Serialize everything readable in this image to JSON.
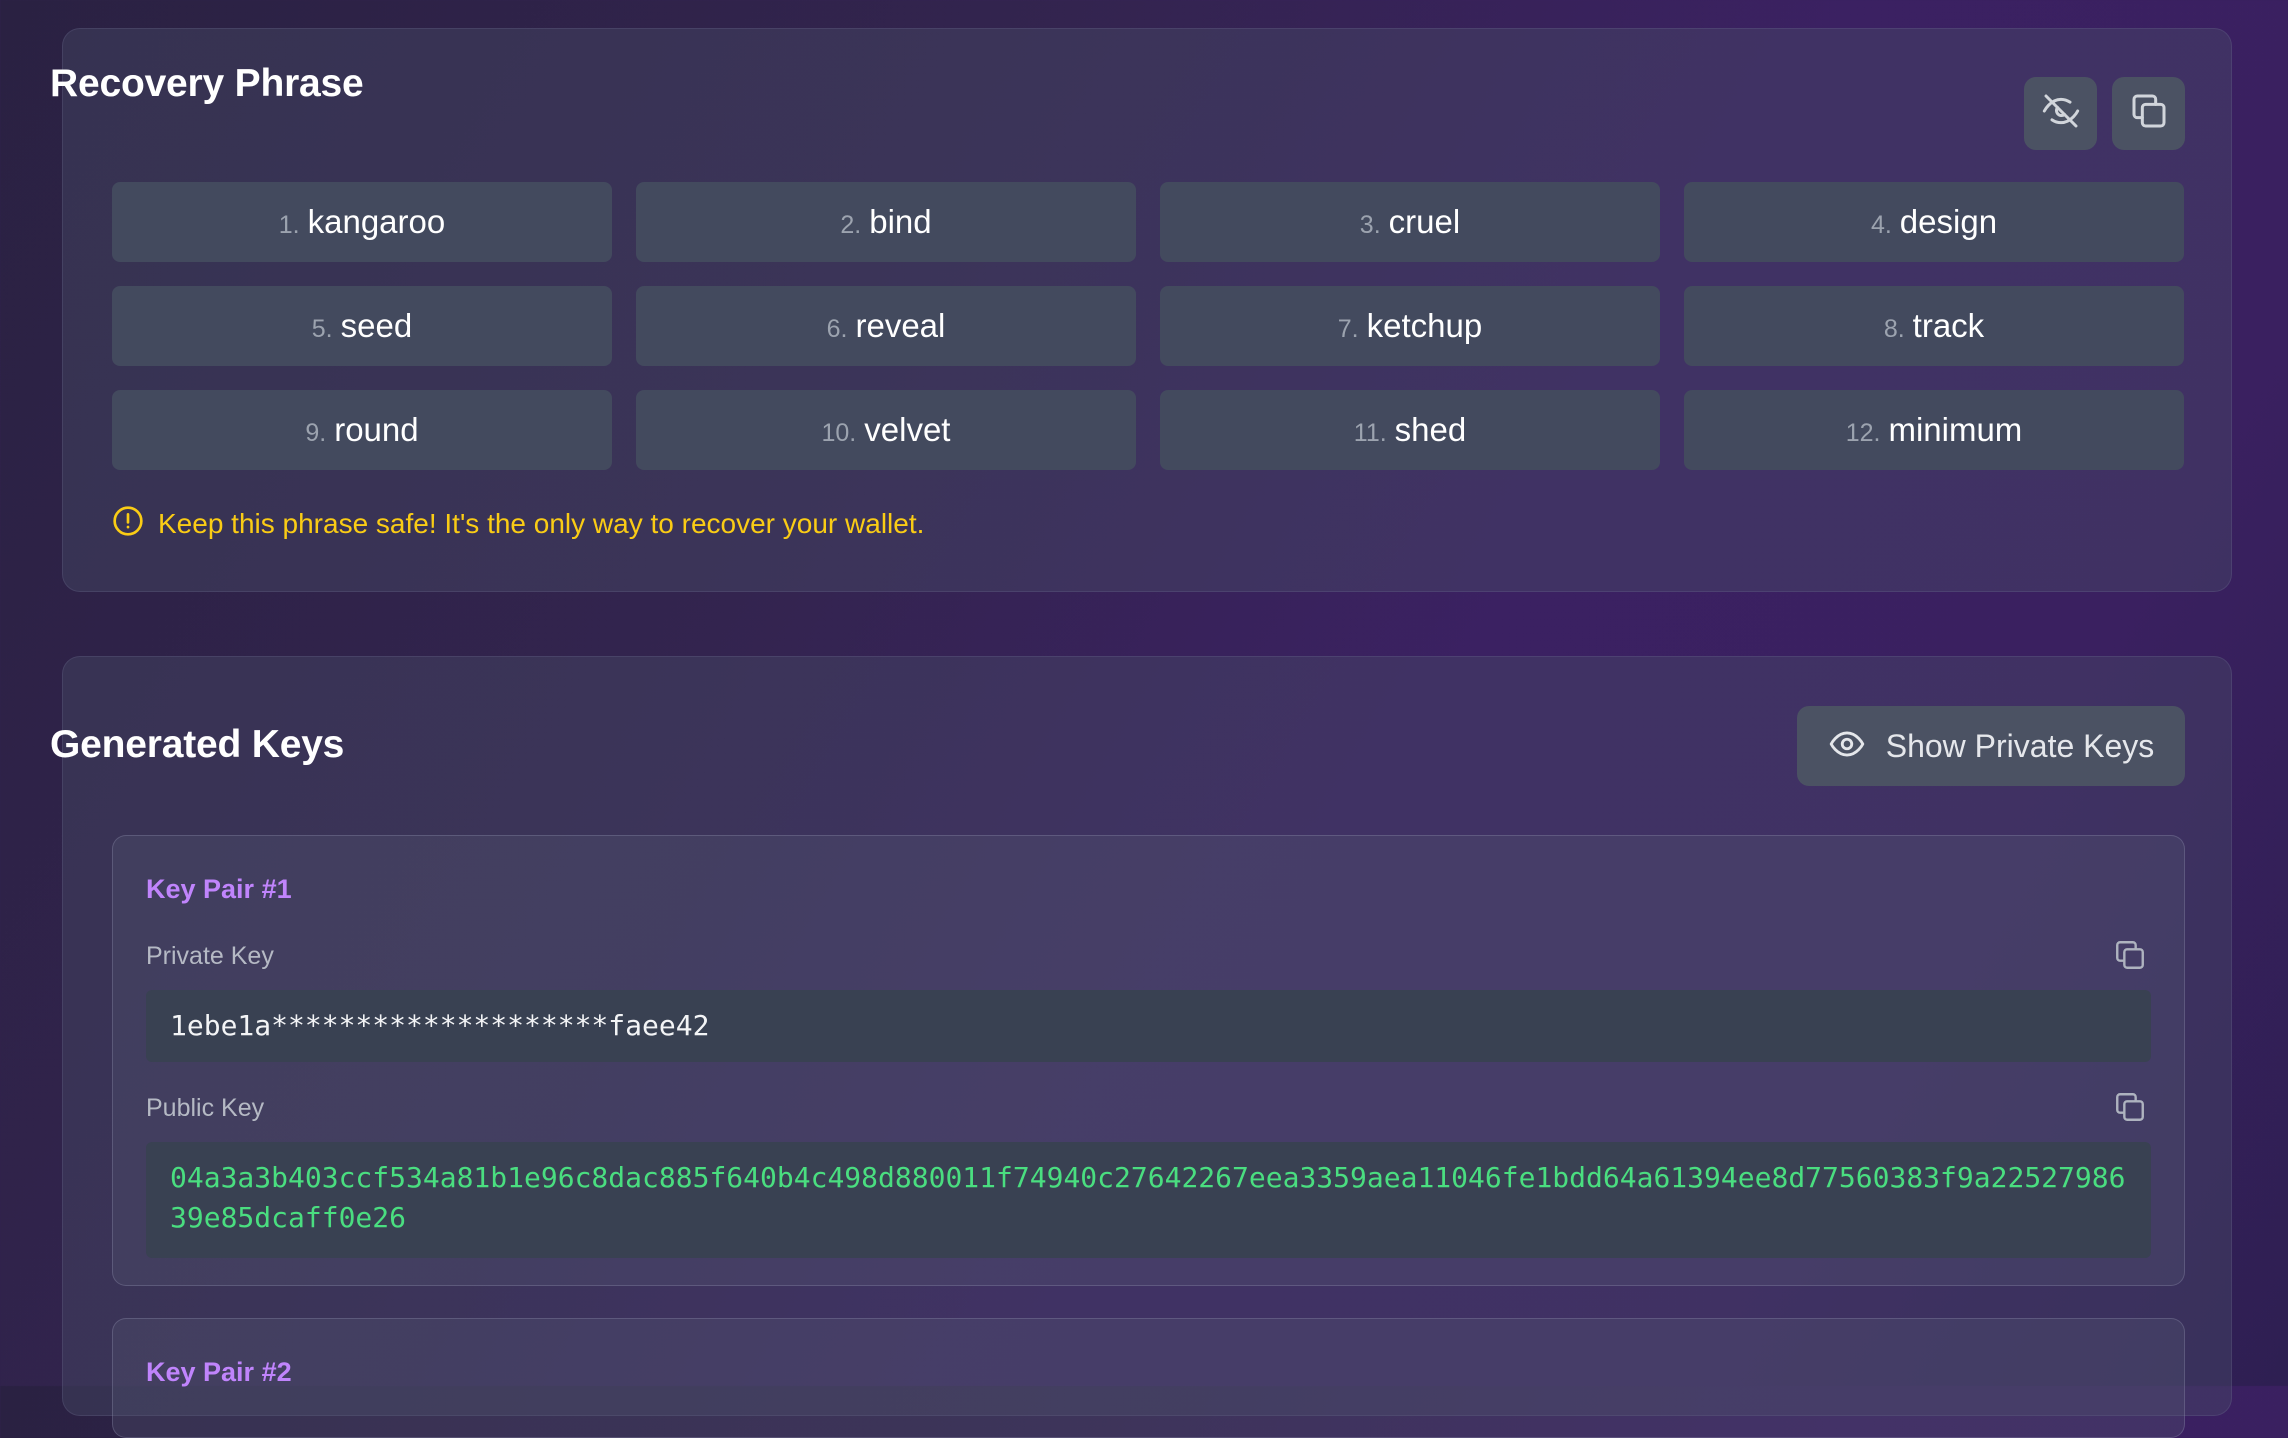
{
  "recovery": {
    "title": "Recovery Phrase",
    "words": [
      {
        "num": "1.",
        "word": "kangaroo"
      },
      {
        "num": "2.",
        "word": "bind"
      },
      {
        "num": "3.",
        "word": "cruel"
      },
      {
        "num": "4.",
        "word": "design"
      },
      {
        "num": "5.",
        "word": "seed"
      },
      {
        "num": "6.",
        "word": "reveal"
      },
      {
        "num": "7.",
        "word": "ketchup"
      },
      {
        "num": "8.",
        "word": "track"
      },
      {
        "num": "9.",
        "word": "round"
      },
      {
        "num": "10.",
        "word": "velvet"
      },
      {
        "num": "11.",
        "word": "shed"
      },
      {
        "num": "12.",
        "word": "minimum"
      }
    ],
    "warning": "Keep this phrase safe! It's the only way to recover your wallet.",
    "icons": {
      "hide": "eye-off-icon",
      "copy": "copy-icon",
      "warning": "alert-circle-icon"
    }
  },
  "keys": {
    "title": "Generated Keys",
    "show_button_label": "Show Private Keys",
    "pairs": [
      {
        "title": "Key Pair #1",
        "private_label": "Private Key",
        "private_value": "1ebe1a********************faee42",
        "public_label": "Public Key",
        "public_value": "04a3a3b403ccf534a81b1e96c8dac885f640b4c498d880011f74940c27642267eea3359aea11046fe1bdd64a61394ee8d77560383f9a2252798639e85dcaff0e26"
      },
      {
        "title": "Key Pair #2"
      }
    ]
  },
  "colors": {
    "warning": "#facc15",
    "keypair_title": "#c084fc",
    "public_key": "#4ade80"
  }
}
